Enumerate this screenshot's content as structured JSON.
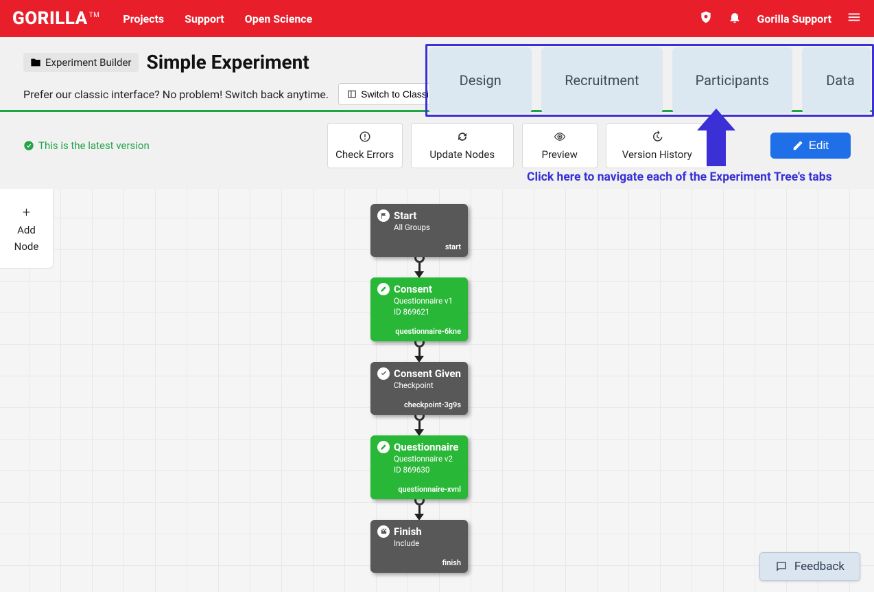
{
  "brand": {
    "name": "GORILLA",
    "tm": "TM"
  },
  "nav": {
    "links": [
      "Projects",
      "Support",
      "Open Science"
    ],
    "user": "Gorilla Support"
  },
  "breadcrumb": {
    "label": "Experiment Builder"
  },
  "page_title": "Simple Experiment",
  "classic_prompt": "Prefer our classic interface? No problem! Switch back anytime.",
  "switch_btn": "Switch to Classic",
  "tabs": [
    "Design",
    "Recruitment",
    "Participants",
    "Data"
  ],
  "version_status": "This is the latest version",
  "toolbar": {
    "check_errors": "Check Errors",
    "update_nodes": "Update Nodes",
    "preview": "Preview",
    "version_history": "Version History",
    "edit": "Edit"
  },
  "callout": "Click here to navigate each of the Experiment Tree's tabs",
  "add_node": {
    "line1": "Add",
    "line2": "Node"
  },
  "nodes": [
    {
      "title": "Start",
      "sub1": "All Groups",
      "sub2": "",
      "slug": "start",
      "color": "dark",
      "icon": "flag"
    },
    {
      "title": "Consent",
      "sub1": "Questionnaire v1",
      "sub2": "ID 869621",
      "slug": "questionnaire-6kne",
      "color": "green",
      "icon": "edit"
    },
    {
      "title": "Consent Given",
      "sub1": "Checkpoint",
      "sub2": "",
      "slug": "checkpoint-3g9s",
      "color": "dark",
      "icon": "check"
    },
    {
      "title": "Questionnaire",
      "sub1": "Questionnaire v2",
      "sub2": "ID 869630",
      "slug": "questionnaire-xvnl",
      "color": "green",
      "icon": "edit"
    },
    {
      "title": "Finish",
      "sub1": "Include",
      "sub2": "",
      "slug": "finish",
      "color": "dark",
      "icon": "finish"
    }
  ],
  "feedback": "Feedback"
}
